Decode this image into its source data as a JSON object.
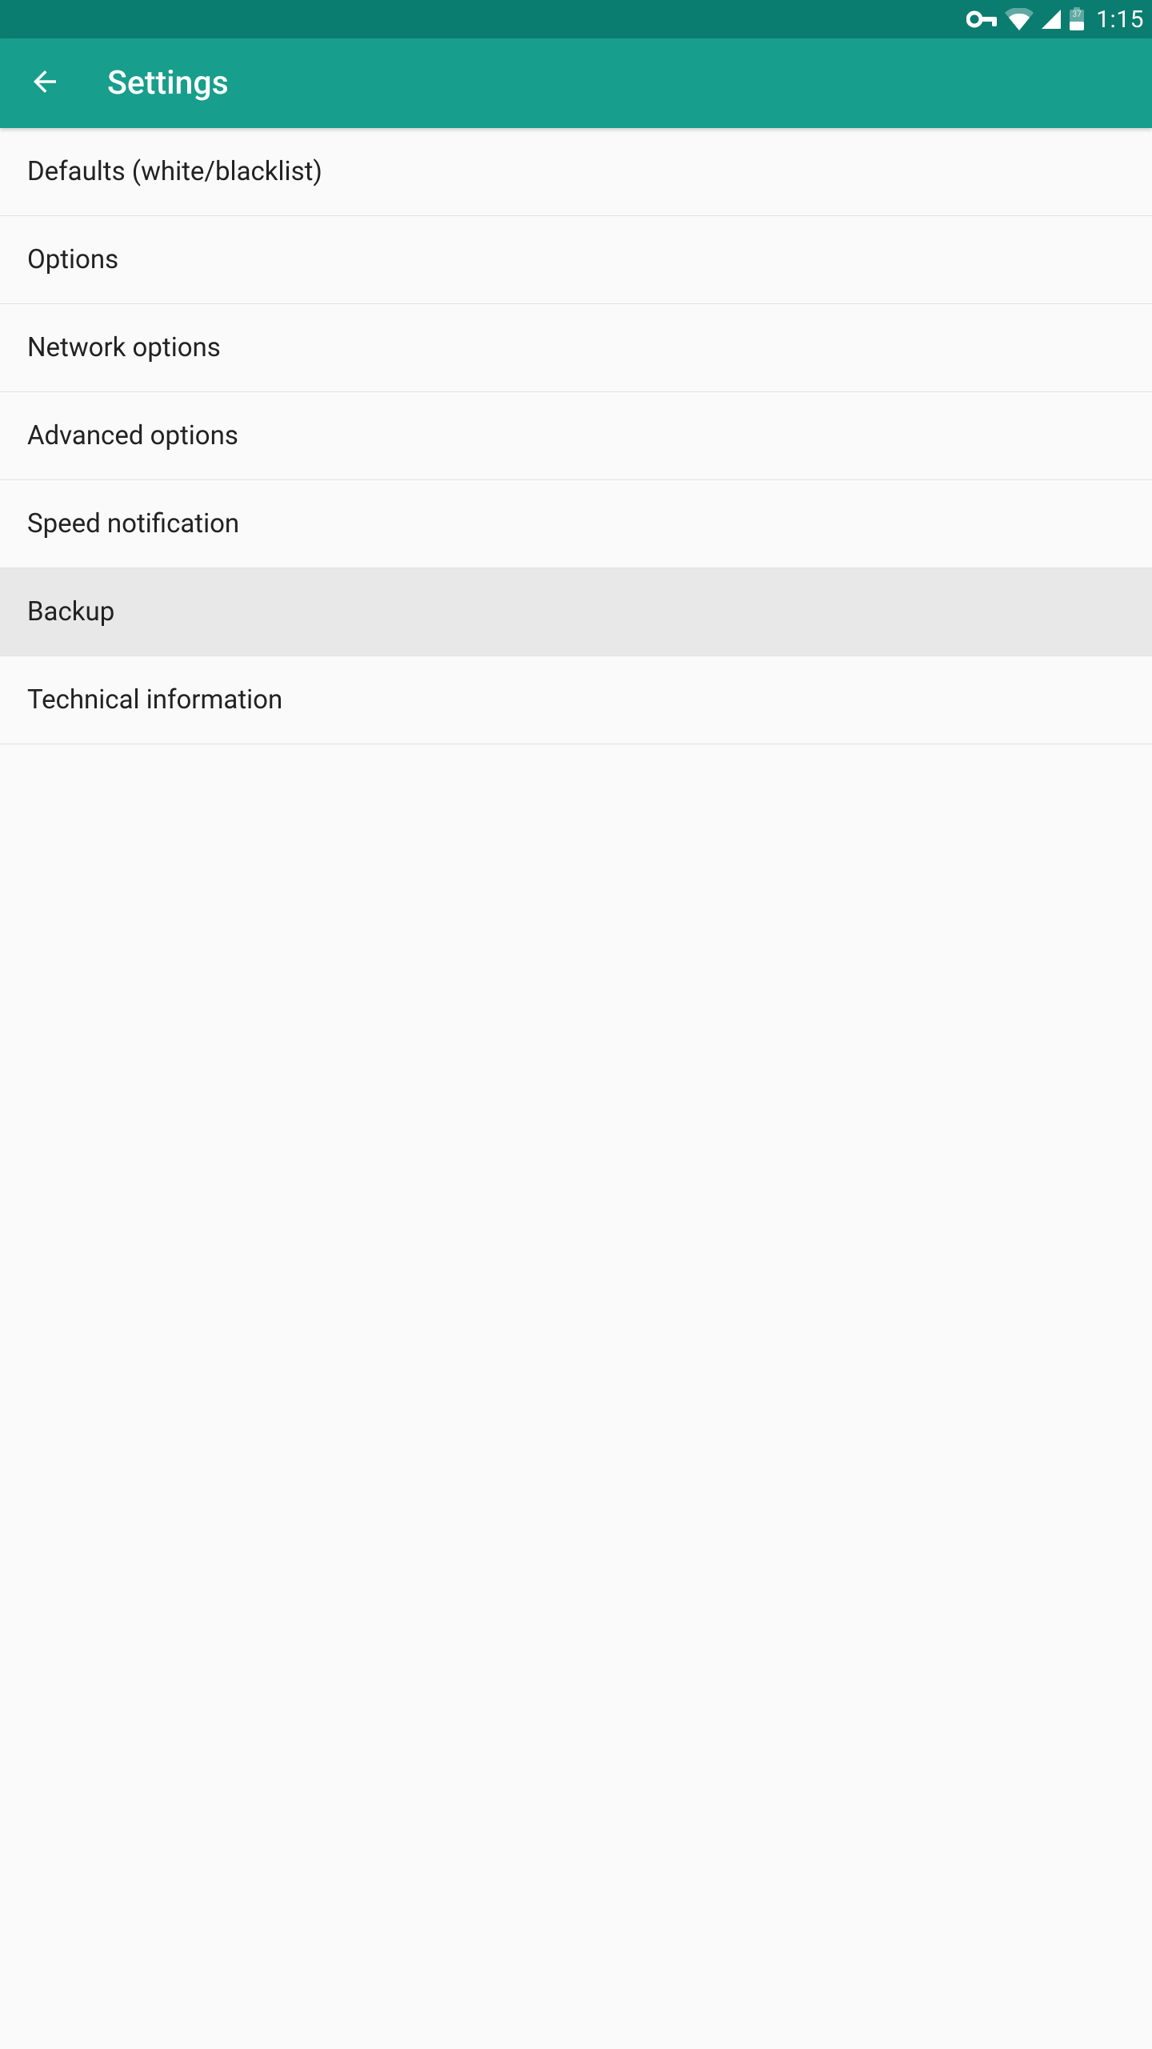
{
  "status_bar": {
    "clock": "1:15",
    "battery_label": "37"
  },
  "app_bar": {
    "title": "Settings"
  },
  "settings": {
    "items": [
      {
        "label": "Defaults (white/blacklist)"
      },
      {
        "label": "Options"
      },
      {
        "label": "Network options"
      },
      {
        "label": "Advanced options"
      },
      {
        "label": "Speed notification"
      },
      {
        "label": "Backup"
      },
      {
        "label": "Technical information"
      }
    ]
  }
}
